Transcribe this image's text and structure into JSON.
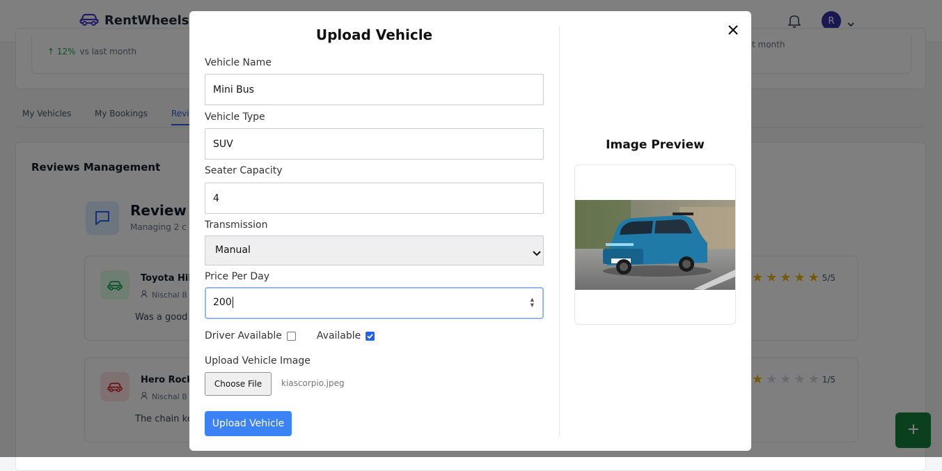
{
  "app": {
    "brand": "RentWheels",
    "avatar_initial": "R"
  },
  "stats": {
    "left_change": "12%",
    "left_note": "vs last month",
    "right_note": "s last month"
  },
  "tabs": [
    {
      "label": "My Vehicles"
    },
    {
      "label": "My Bookings"
    },
    {
      "label": "Revie"
    }
  ],
  "reviews": {
    "section_title": "Reviews Management",
    "header_title": "Review M",
    "header_sub": "Managing 2 c",
    "items": [
      {
        "vehicle": "Toyota Hilu",
        "user": "Nischal B",
        "text": "Was a good",
        "rating_label": "5/5",
        "rating": 5
      },
      {
        "vehicle": "Hero Rocke",
        "user": "Nischal B",
        "text": "The chain ke",
        "rating_label": "1/5",
        "rating": 1
      }
    ]
  },
  "modal": {
    "title": "Upload Vehicle",
    "fields": {
      "vehicle_name": {
        "label": "Vehicle Name",
        "value": "Mini Bus"
      },
      "vehicle_type": {
        "label": "Vehicle Type",
        "value": "SUV"
      },
      "seater_capacity": {
        "label": "Seater Capacity",
        "value": "4"
      },
      "transmission": {
        "label": "Transmission",
        "value": "Manual"
      },
      "price_per_day": {
        "label": "Price Per Day",
        "value": "200"
      }
    },
    "driver_available": {
      "label": "Driver Available",
      "checked": false
    },
    "available": {
      "label": "Available",
      "checked": true
    },
    "image_upload": {
      "label": "Upload Vehicle Image",
      "button": "Choose File",
      "file_name": "kiascorpio.jpeg"
    },
    "submit_label": "Upload Vehicle",
    "preview_title": "Image Preview"
  },
  "colors": {
    "primary": "#3b82f6",
    "fab": "#15803d",
    "star": "#eab308",
    "brand_icon": "#4338ca"
  },
  "icons": [
    "car-icon",
    "bell-icon",
    "chevron-down-icon",
    "message-square-icon",
    "user-icon",
    "star-icon",
    "close-icon",
    "plus-icon"
  ]
}
